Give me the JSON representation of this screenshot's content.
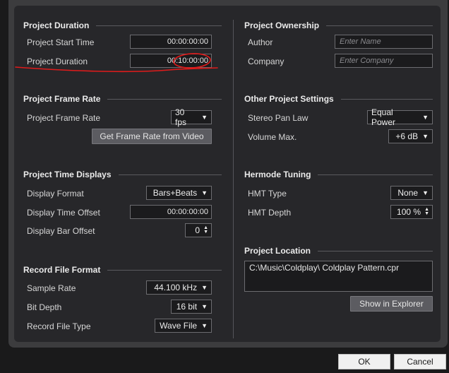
{
  "project_duration": {
    "title": "Project Duration",
    "start_time_label": "Project Start Time",
    "start_time_value": "00:00:00:00",
    "duration_label": "Project Duration",
    "duration_value": "00:10:00:00"
  },
  "frame_rate": {
    "title": "Project Frame Rate",
    "label": "Project Frame Rate",
    "value": "30 fps",
    "get_button": "Get Frame Rate from Video"
  },
  "time_displays": {
    "title": "Project Time Displays",
    "format_label": "Display Format",
    "format_value": "Bars+Beats",
    "offset_label": "Display Time Offset",
    "offset_value": "00:00:00:00",
    "bar_offset_label": "Display Bar Offset",
    "bar_offset_value": "0"
  },
  "record_format": {
    "title": "Record File Format",
    "sample_rate_label": "Sample Rate",
    "sample_rate_value": "44.100 kHz",
    "bit_depth_label": "Bit Depth",
    "bit_depth_value": "16 bit",
    "file_type_label": "Record File Type",
    "file_type_value": "Wave File"
  },
  "ownership": {
    "title": "Project Ownership",
    "author_label": "Author",
    "author_placeholder": "Enter Name",
    "company_label": "Company",
    "company_placeholder": "Enter Company"
  },
  "other_settings": {
    "title": "Other Project Settings",
    "pan_law_label": "Stereo Pan Law",
    "pan_law_value": "Equal Power",
    "volume_label": "Volume Max.",
    "volume_value": "+6 dB"
  },
  "hermode": {
    "title": "Hermode Tuning",
    "type_label": "HMT Type",
    "type_value": "None",
    "depth_label": "HMT Depth",
    "depth_value": "100 %"
  },
  "location": {
    "title": "Project Location",
    "path": "C:\\Music\\Coldplay\\ Coldplay Pattern.cpr",
    "show_button": "Show in Explorer"
  },
  "footer": {
    "ok": "OK",
    "cancel": "Cancel"
  },
  "colors": {
    "annotation": "#e01b1b",
    "panel": "#27272a",
    "frame": "#3c3c3e"
  }
}
